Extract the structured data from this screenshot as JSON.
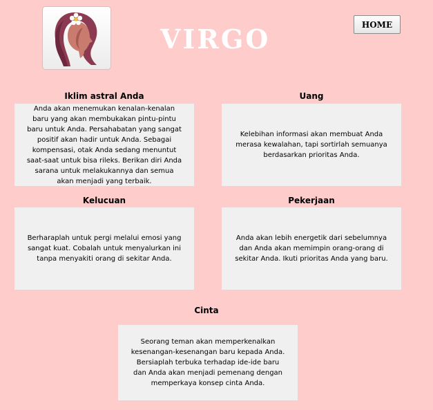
{
  "header": {
    "title": "VIRGO",
    "home_button": "HOME"
  },
  "sections": [
    {
      "heading": "Iklim astral Anda",
      "text": "Anda akan menemukan kenalan-kenalan baru yang akan membukakan pintu-pintu baru untuk Anda. Persahabatan yang sangat positif akan hadir untuk Anda. Sebagai kompensasi, otak Anda sedang menuntut saat-saat untuk bisa rileks. Berikan diri Anda sarana untuk melakukannya dan semua akan menjadi yang terbaik."
    },
    {
      "heading": "Uang",
      "text": "Kelebihan informasi akan membuat Anda merasa kewalahan, tapi sortirlah semuanya berdasarkan prioritas Anda."
    },
    {
      "heading": "Kelucuan",
      "text": "Berharaplah untuk pergi melalui emosi yang sangat kuat. Cobalah untuk menyalurkan ini tanpa menyakiti orang di sekitar Anda."
    },
    {
      "heading": "Pekerjaan",
      "text": "Anda akan lebih energetik dari sebelumnya dan Anda akan memimpin orang-orang di sekitar Anda. Ikuti prioritas Anda yang baru."
    },
    {
      "heading": "Cinta",
      "text": "Seorang teman akan memperkenalkan kesenangan-kesenangan baru kepada Anda. Bersiaplah terbuka terhadap ide-ide baru dan Anda akan menjadi pemenang dengan memperkaya konsep cinta Anda."
    }
  ],
  "icons": {
    "logo": "virgo-woman-silhouette-icon"
  },
  "colors": {
    "background": "#ffcccc",
    "panel": "#f0f0f0",
    "hair": "#8c3a52",
    "title": "#ffffff"
  }
}
